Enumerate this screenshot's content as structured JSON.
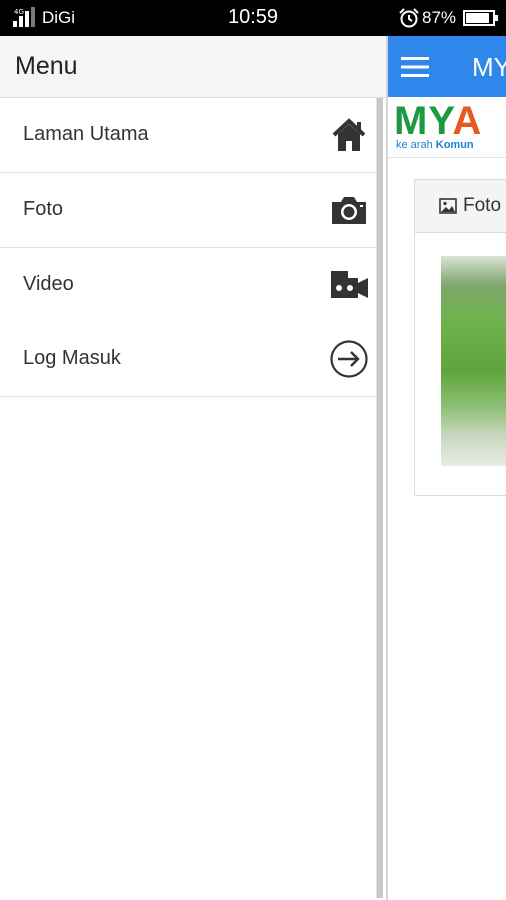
{
  "status_bar": {
    "carrier": "DiGi",
    "time": "10:59",
    "battery": "87%",
    "icons": [
      "signal-icon",
      "alarm-icon",
      "battery-icon"
    ]
  },
  "drawer": {
    "title": "Menu",
    "items": [
      {
        "label": "Laman Utama",
        "icon": "home-icon"
      },
      {
        "label": "Foto",
        "icon": "camera-icon"
      },
      {
        "label": "Video",
        "icon": "video-camera-icon"
      },
      {
        "label": "Log Masuk",
        "icon": "login-arrow-icon"
      }
    ]
  },
  "background_app": {
    "toolbar_title": "MY",
    "toolbar_color": "#2f86eb",
    "logo_text": "MYA",
    "tagline_prefix": "ke arah ",
    "tagline_bold": "Komun",
    "card_title": "Foto"
  }
}
